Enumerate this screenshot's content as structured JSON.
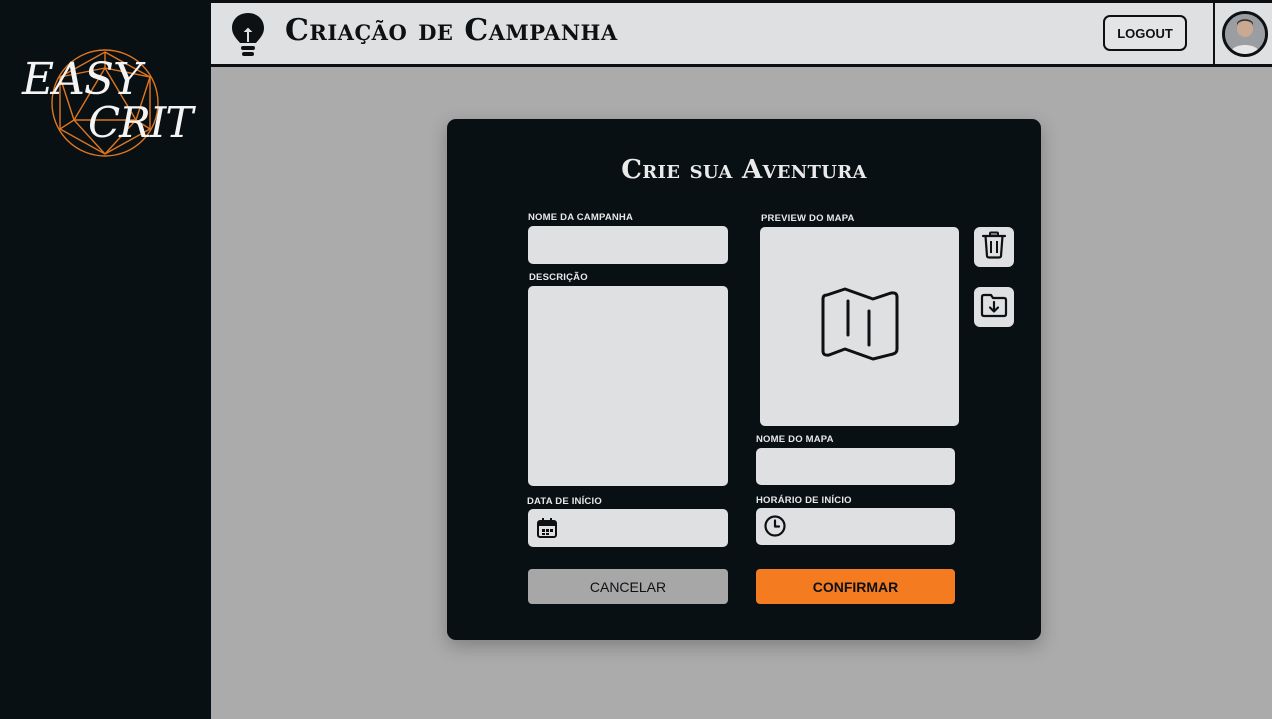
{
  "app": {
    "logo_line1": "EASY",
    "logo_line2": "CRIT",
    "logo_accent_color": "#e0761f"
  },
  "header": {
    "title": "Criação de Campanha",
    "logout_label": "LOGOUT"
  },
  "form": {
    "title": "Crie sua Aventura",
    "campaign_name_label": "NOME DA CAMPANHA",
    "campaign_name_value": "",
    "description_label": "DESCRIÇÃO",
    "description_value": "",
    "start_date_label": "DATA DE INÍCIO",
    "start_date_value": "",
    "map_preview_label": "PREVIEW DO MAPA",
    "map_name_label": "NOME DO MAPA",
    "map_name_value": "",
    "start_time_label": "HORÁRIO DE INÍCIO",
    "start_time_value": "",
    "cancel_label": "CANCELAR",
    "confirm_label": "CONFIRMAR"
  },
  "icons": {
    "header": "lightbulb-icon",
    "delete": "trash-icon",
    "upload": "folder-download-icon",
    "map": "map-icon",
    "date": "calendar-icon",
    "time": "clock-icon"
  },
  "colors": {
    "sidebar": "#081013",
    "header": "#dfe0e2",
    "background": "#ababab",
    "modal": "#081013",
    "field": "#dfe0e2",
    "confirm": "#f47b20",
    "cancel": "#a7a7a7"
  }
}
